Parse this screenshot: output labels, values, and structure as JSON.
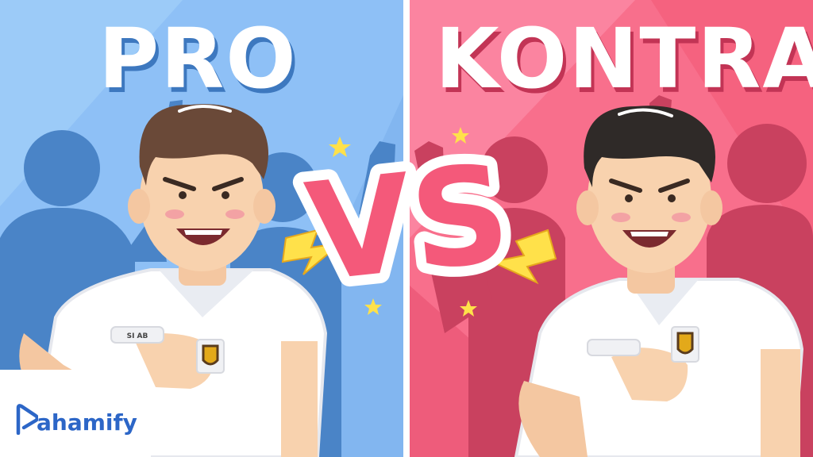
{
  "left_panel": {
    "title": "PRO",
    "bg_color": "#8ec0f6",
    "shadow_color": "#4a84c7"
  },
  "right_panel": {
    "title": "KONTRA",
    "bg_color": "#f86f8c",
    "shadow_color": "#c9415f"
  },
  "center": {
    "vs_text": "VS",
    "vs_color": "#f4597a"
  },
  "left_character": {
    "name_tag": "SI AB",
    "badge_icon": "school-shield-icon"
  },
  "right_character": {
    "name_tag": "",
    "badge_icon": "school-shield-icon"
  },
  "decorations": {
    "icons": [
      "star-icon",
      "lightning-bolt-icon",
      "crowd-silhouette"
    ]
  },
  "brand": {
    "logo_text": "ahamify",
    "logo_icon": "pahamify-p-play-icon",
    "color": "#2c66c7"
  }
}
